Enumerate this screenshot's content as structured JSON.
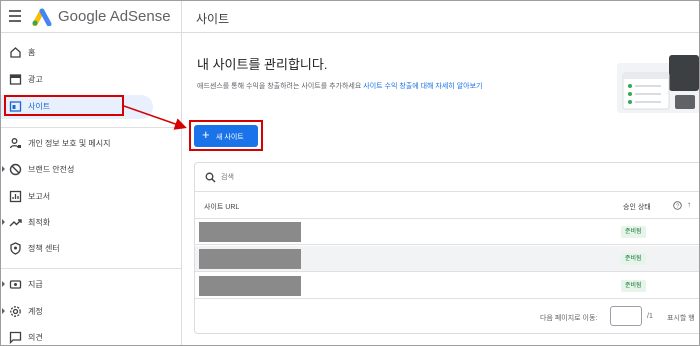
{
  "app": {
    "title": "Google AdSense",
    "page_title": "사이트"
  },
  "sidebar": {
    "items": [
      {
        "label": "홈",
        "icon": "home-icon"
      },
      {
        "label": "광고",
        "icon": "ads-icon"
      },
      {
        "label": "사이트",
        "icon": "sites-icon",
        "active": true
      },
      {
        "label": "개인 정보 보호 및 메시지",
        "icon": "privacy-icon"
      },
      {
        "label": "브랜드 안전성",
        "icon": "block-icon"
      },
      {
        "label": "보고서",
        "icon": "reports-icon"
      },
      {
        "label": "최적화",
        "icon": "trending-icon"
      },
      {
        "label": "정책 센터",
        "icon": "shield-icon"
      },
      {
        "label": "지급",
        "icon": "payments-icon"
      },
      {
        "label": "계정",
        "icon": "gear-icon"
      },
      {
        "label": "의견",
        "icon": "feedback-icon"
      }
    ]
  },
  "main": {
    "heading": "내 사이트를 관리합니다.",
    "description": "애드센스를 통해 수익을 창출하려는 사이트를 추가하세요",
    "description_link": "사이트 수익 창출에 대해 자세히 알아보기",
    "new_site_button": "새 사이트"
  },
  "table": {
    "search_placeholder": "검색",
    "col_url": "사이트 URL",
    "col_status": "승인 상태",
    "rows": [
      {
        "url": "",
        "status": "준비됨"
      },
      {
        "url": "",
        "status": "준비됨"
      },
      {
        "url": "",
        "status": "준비됨"
      }
    ],
    "pager_label": "다음 페이지로 이동:",
    "pager_value": "",
    "pager_total": "/1",
    "pager_count": "표시할 행"
  },
  "colors": {
    "accent": "#1a73e8",
    "annotation": "#d50000",
    "status_bg": "#e6f4ea",
    "status_fg": "#137333"
  }
}
